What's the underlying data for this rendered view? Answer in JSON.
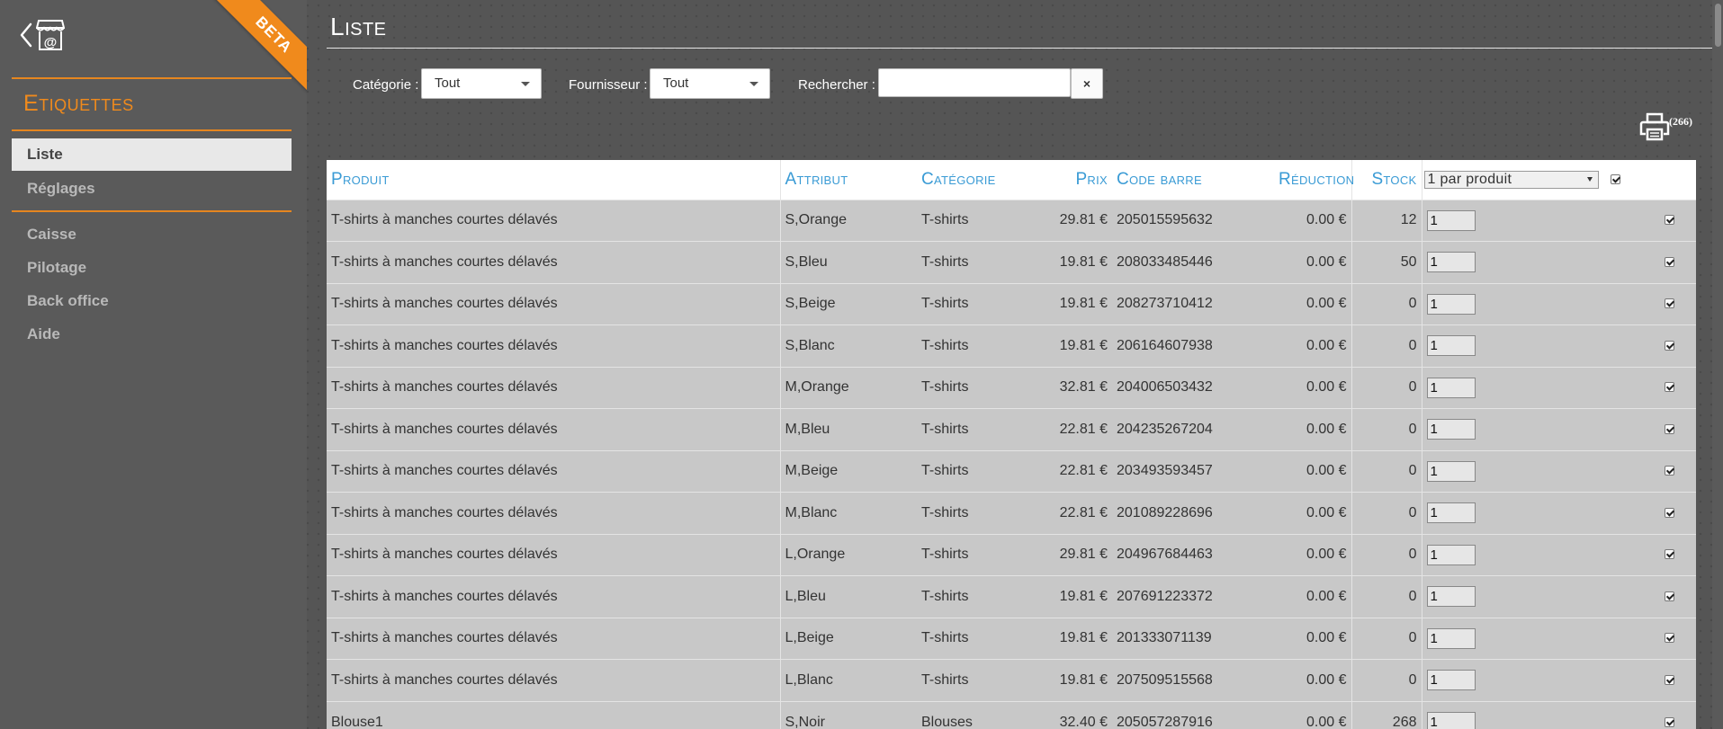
{
  "sidebar": {
    "beta": "BETA",
    "title": "Etiquettes",
    "items": [
      {
        "label": "Liste"
      },
      {
        "label": "Réglages"
      },
      {
        "label": "Caisse"
      },
      {
        "label": "Pilotage"
      },
      {
        "label": "Back office"
      },
      {
        "label": "Aide"
      }
    ]
  },
  "main": {
    "title": "Liste",
    "filters": {
      "category_label": "Catégorie :",
      "category_value": "Tout",
      "supplier_label": "Fournisseur :",
      "supplier_value": "Tout",
      "search_label": "Rechercher :",
      "search_value": "",
      "clear_icon": "×"
    },
    "print_count": "(266)"
  },
  "table": {
    "headers": {
      "product": "Produit",
      "attribute": "Attribut",
      "category": "Catégorie",
      "price": "Prix",
      "barcode": "Code barre",
      "reduction": "Réduction",
      "stock": "Stock",
      "per_product": "1 par produit"
    },
    "rows": [
      {
        "product": "T-shirts à manches courtes délavés",
        "attribute": "S,Orange",
        "category": "T-shirts",
        "price": "29.81 €",
        "barcode": "205015595632",
        "reduction": "0.00 €",
        "stock": "12",
        "qty": "1"
      },
      {
        "product": "T-shirts à manches courtes délavés",
        "attribute": "S,Bleu",
        "category": "T-shirts",
        "price": "19.81 €",
        "barcode": "208033485446",
        "reduction": "0.00 €",
        "stock": "50",
        "qty": "1"
      },
      {
        "product": "T-shirts à manches courtes délavés",
        "attribute": "S,Beige",
        "category": "T-shirts",
        "price": "19.81 €",
        "barcode": "208273710412",
        "reduction": "0.00 €",
        "stock": "0",
        "qty": "1"
      },
      {
        "product": "T-shirts à manches courtes délavés",
        "attribute": "S,Blanc",
        "category": "T-shirts",
        "price": "19.81 €",
        "barcode": "206164607938",
        "reduction": "0.00 €",
        "stock": "0",
        "qty": "1"
      },
      {
        "product": "T-shirts à manches courtes délavés",
        "attribute": "M,Orange",
        "category": "T-shirts",
        "price": "32.81 €",
        "barcode": "204006503432",
        "reduction": "0.00 €",
        "stock": "0",
        "qty": "1"
      },
      {
        "product": "T-shirts à manches courtes délavés",
        "attribute": "M,Bleu",
        "category": "T-shirts",
        "price": "22.81 €",
        "barcode": "204235267204",
        "reduction": "0.00 €",
        "stock": "0",
        "qty": "1"
      },
      {
        "product": "T-shirts à manches courtes délavés",
        "attribute": "M,Beige",
        "category": "T-shirts",
        "price": "22.81 €",
        "barcode": "203493593457",
        "reduction": "0.00 €",
        "stock": "0",
        "qty": "1"
      },
      {
        "product": "T-shirts à manches courtes délavés",
        "attribute": "M,Blanc",
        "category": "T-shirts",
        "price": "22.81 €",
        "barcode": "201089228696",
        "reduction": "0.00 €",
        "stock": "0",
        "qty": "1"
      },
      {
        "product": "T-shirts à manches courtes délavés",
        "attribute": "L,Orange",
        "category": "T-shirts",
        "price": "29.81 €",
        "barcode": "204967684463",
        "reduction": "0.00 €",
        "stock": "0",
        "qty": "1"
      },
      {
        "product": "T-shirts à manches courtes délavés",
        "attribute": "L,Bleu",
        "category": "T-shirts",
        "price": "19.81 €",
        "barcode": "207691223372",
        "reduction": "0.00 €",
        "stock": "0",
        "qty": "1"
      },
      {
        "product": "T-shirts à manches courtes délavés",
        "attribute": "L,Beige",
        "category": "T-shirts",
        "price": "19.81 €",
        "barcode": "201333071139",
        "reduction": "0.00 €",
        "stock": "0",
        "qty": "1"
      },
      {
        "product": "T-shirts à manches courtes délavés",
        "attribute": "L,Blanc",
        "category": "T-shirts",
        "price": "19.81 €",
        "barcode": "207509515568",
        "reduction": "0.00 €",
        "stock": "0",
        "qty": "1"
      },
      {
        "product": "Blouse1",
        "attribute": "S,Noir",
        "category": "Blouses",
        "price": "32.40 €",
        "barcode": "205057287916",
        "reduction": "0.00 €",
        "stock": "268",
        "qty": "1"
      }
    ]
  },
  "colors": {
    "accent": "#f08a1c",
    "header_text": "#3a9bd5",
    "row_bg": "#c8c8c8",
    "page_bg": "#555555"
  },
  "icons": {
    "back": "chevron-left-icon",
    "shop": "shop-icon",
    "print": "printer-icon",
    "clear": "close-icon"
  }
}
